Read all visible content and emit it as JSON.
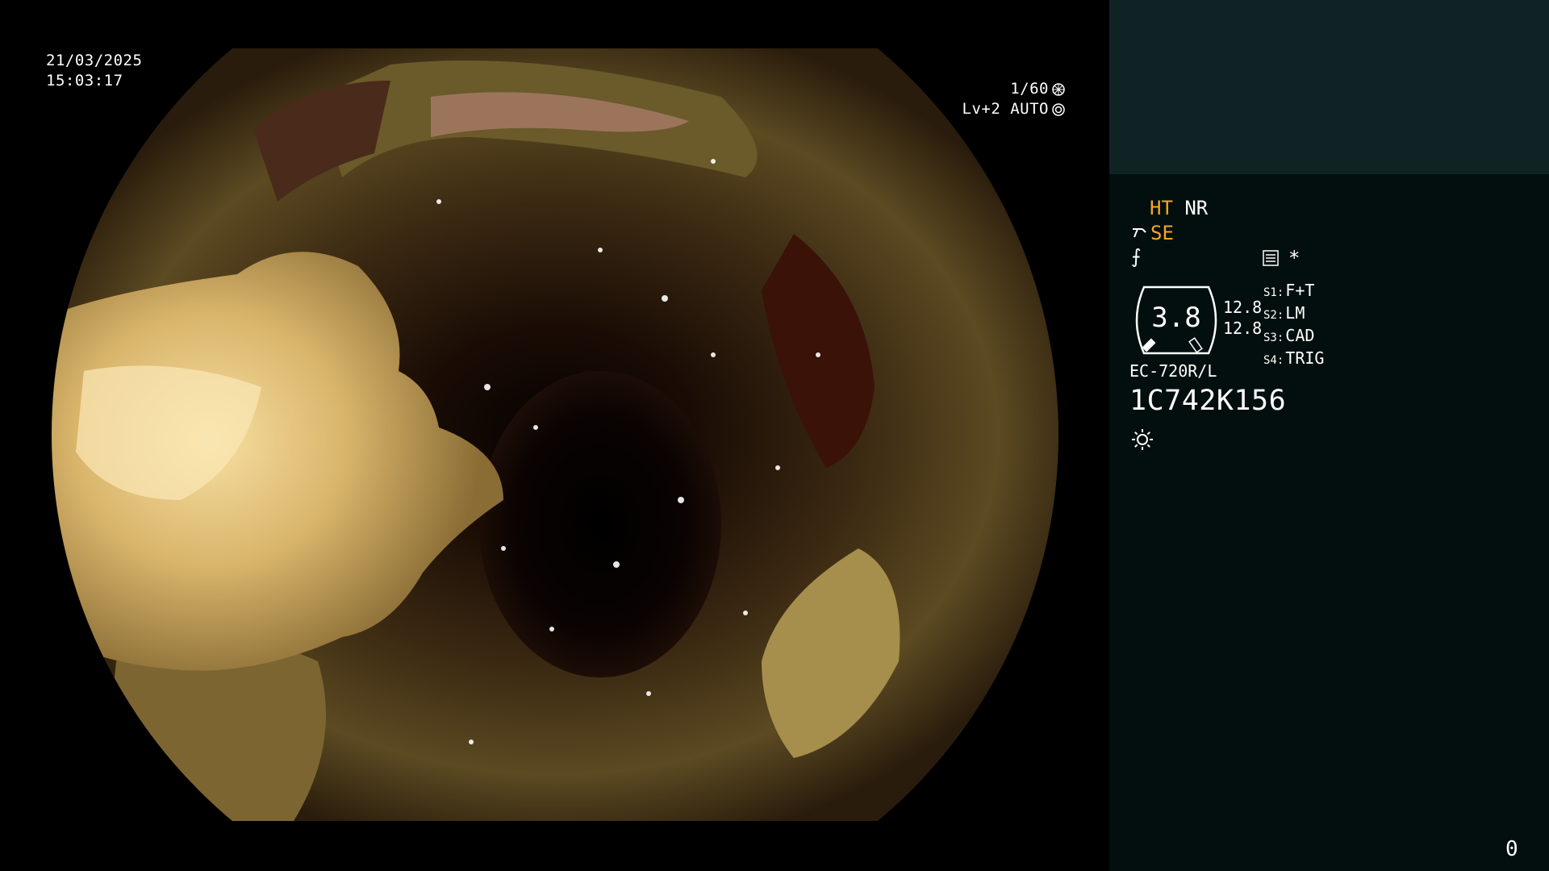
{
  "overlay": {
    "date": "21/03/2025",
    "time": "15:03:17",
    "shutter": "1/60",
    "level": "Lv+2 AUTO"
  },
  "panel": {
    "ht": "HT",
    "nr": "NR",
    "se": "SE",
    "f_symbol": "⨍",
    "asterisk": "*",
    "gauge_value": "3.8",
    "gauge_num_1": "12.8",
    "gauge_num_2": "12.8",
    "settings": [
      {
        "key": "S1:",
        "value": "F+T"
      },
      {
        "key": "S2:",
        "value": "LM"
      },
      {
        "key": "S3:",
        "value": "CAD"
      },
      {
        "key": "S4:",
        "value": "TRIG"
      }
    ],
    "model": "EC-720R/L",
    "serial": "1C742K156",
    "counter": "0"
  },
  "colors": {
    "panel_bg": "#030f0e",
    "panel_top_bg": "#0f2324",
    "accent_amber": "#f5a623"
  },
  "icons": [
    "shutter-icon",
    "auto-iris-icon",
    "scissor-icon",
    "f-function-icon",
    "menu-list-icon",
    "gauge-icon",
    "brightness-sun-icon"
  ]
}
